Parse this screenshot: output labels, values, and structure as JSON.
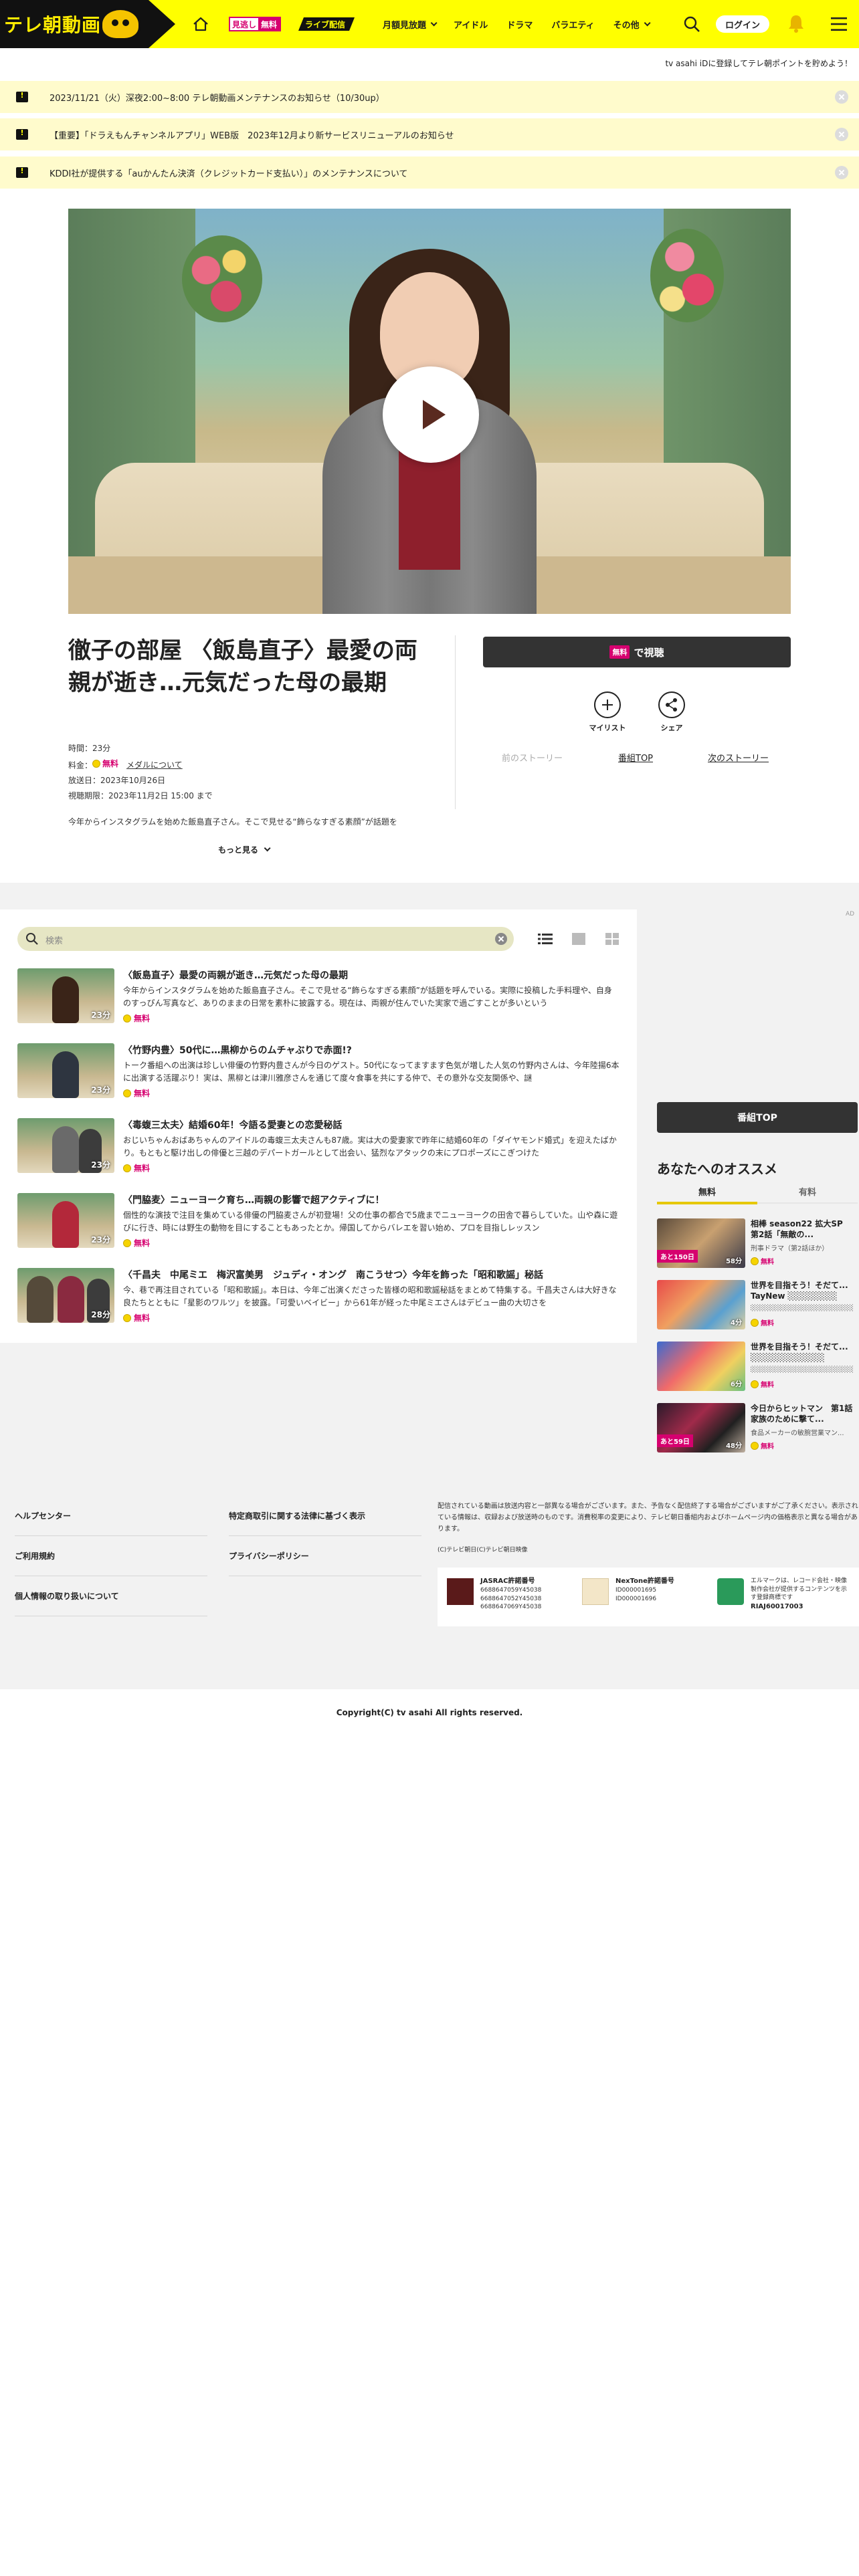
{
  "header": {
    "logo_text": "テレ朝動画",
    "mitogashi_a": "見逃し",
    "mitogashi_b": "無料",
    "live_label": "ライブ配信",
    "nav": [
      "月額見放題",
      "アイドル",
      "ドラマ",
      "バラエティ",
      "その他"
    ],
    "login_label": "ログイン",
    "accent_color": "#ffff00"
  },
  "register_note": "tv asahi iDに登録してテレ朝ポイントを貯めよう！",
  "notices": [
    "2023/11/21（火）深夜2:00~8:00 テレ朝動画メンテナンスのお知らせ（10/30up）",
    "【重要】「ドラえもんチャンネルアプリ」WEB版　2023年12月より新サービスリニューアルのお知らせ",
    "KDDI社が提供する「auかんたん決済（クレジットカード支払い）」のメンテナンスについて"
  ],
  "episode": {
    "title": "徹子の部屋 〈飯島直子〉最愛の両親が逝き…元気だった母の最期",
    "duration": "時間：23分",
    "fee_label": "料金：",
    "fee_value": "無料",
    "medal_link": "メダルについて",
    "aired": "放送日：2023年10月26日",
    "expires": "視聴期限：2023年11月2日 15:00 まで",
    "description": "今年からインスタグラムを始めた飯島直子さん。そこで見せる“飾らなすぎる素顔”が話題を",
    "more_label": "もっと見る"
  },
  "actions": {
    "watch_tag": "無料",
    "watch_label": "で視聴",
    "mylist_label": "マイリスト",
    "share_label": "シェア",
    "prev_story": "前のストーリー",
    "program_top": "番組TOP",
    "next_story": "次のストーリー"
  },
  "list": {
    "search_placeholder": "検索",
    "free_label": "無料",
    "items": [
      {
        "title": "〈飯島直子〉最愛の両親が逝き…元気だった母の最期",
        "desc": "今年からインスタグラムを始めた飯島直子さん。そこで見せる“飾らなすぎる素顔”が話題を呼んでいる。実際に投稿した手料理や、自身のすっぴん写真など、ありのままの日常を素朴に披露する。現在は、両親が住んでいた実家で過ごすことが多いという",
        "duration": "23分"
      },
      {
        "title": "〈竹野内豊〉50代に…黒柳からのムチャぶりで赤面!?",
        "desc": "トーク番組への出演は珍しい俳優の竹野内豊さんが今日のゲスト。50代になってますます色気が増した人気の竹野内さんは、今年陸揚6本に出演する活躍ぶり！実は、黒柳とは津川雅彦さんを通じて度々食事を共にする仲で、その意外な交友関係や、謎",
        "duration": "23分"
      },
      {
        "title": "〈毒蝮三太夫〉結婚60年！今語る愛妻との恋愛秘話",
        "desc": "おじいちゃんおばあちゃんのアイドルの毒蝮三太夫さんも87歳。実は大の愛妻家で昨年に結婚60年の「ダイヤモンド婚式」を迎えたばかり。もともと駆け出しの俳優と三越のデパートガールとして出会い、猛烈なアタックの末にプロポーズにこぎつけた",
        "duration": "23分"
      },
      {
        "title": "〈門脇麦〉ニューヨーク育ち…両親の影響で超アクティブに！",
        "desc": "個性的な演技で注目を集めている俳優の門脇麦さんが初登場！父の仕事の都合で5歳までニューヨークの田舎で暮らしていた。山や森に遊びに行き、時には野生の動物を目にすることもあったとか。帰国してからバレエを習い始め、プロを目指しレッスン",
        "duration": "23分"
      },
      {
        "title": "〈千昌夫　中尾ミエ　梅沢富美男　ジュディ・オング　南こうせつ〉今年を飾った「昭和歌謡」秘話",
        "desc": "今、巷で再注目されている「昭和歌謡」。本日は、今年ご出演くださった皆様の昭和歌謡秘話をまとめて特集する。千昌夫さんは大好きな良たちとともに「星影のワルツ」を披露。「可愛いベイビー」から61年が経った中尾ミエさんはデビュー曲の大切さを",
        "duration": "28分"
      }
    ]
  },
  "sidebar": {
    "ad_label": "AD",
    "program_top": "番組TOP",
    "rec_heading": "あなたへのオススメ",
    "tab_free": "無料",
    "tab_paid": "有料",
    "free_label": "無料",
    "items": [
      {
        "title": "相棒 season22 拡大SP　第2話「無敵の...",
        "sub": "刑事ドラマ（第2話ほか）",
        "tag": "あと150日",
        "duration": "58分"
      },
      {
        "title": "世界を目指そう！そだて... TayNew ░░░░░░░░",
        "sub": "░░░░░░░░░░░░░░░░░░░░",
        "tag": "",
        "duration": "4分"
      },
      {
        "title": "世界を目指そう！そだて... ░░░░░░░░░░░░",
        "sub": "░░░░░░░░░░░░░░░░░░░░",
        "tag": "",
        "duration": "6分"
      },
      {
        "title": "今日からヒットマン　第1話 家族のために撃て...",
        "sub": "食品メーカーの敏腕営業マン...",
        "tag": "あと59日",
        "duration": "48分"
      }
    ]
  },
  "footer": {
    "links_left": [
      "ヘルプセンター",
      "ご利用規約",
      "個人情報の取り扱いについて"
    ],
    "links_mid": [
      "特定商取引に関する法律に基づく表示",
      "プライバシーポリシー"
    ],
    "note": "配信されている動画は放送内容と一部異なる場合がございます。また、予告なく配信終了する場合がございますがご了承ください。表示されている情報は、収録および放送時のものです。消費税率の変更により、テレビ朝日番組内およびホームページ内の価格表示と異なる場合があります。",
    "small_copy": "(C)テレビ朝日(C)テレビ朝日映像",
    "licenses": [
      {
        "name": "JASRAC許諾番号",
        "nums": [
          "6688647059Y45038",
          "6688647052Y45038",
          "6688647069Y45038"
        ]
      },
      {
        "name": "NexTone許諾番号",
        "nums": [
          "ID000001695",
          "ID000001696"
        ]
      },
      {
        "name": "エルマークは、レコード会社・映像製作会社が提供するコンテンツを示す登録商標です",
        "nums": [
          "RIAJ60017003"
        ]
      }
    ]
  },
  "copyright": "Copyright(C) tv asahi All rights reserved."
}
